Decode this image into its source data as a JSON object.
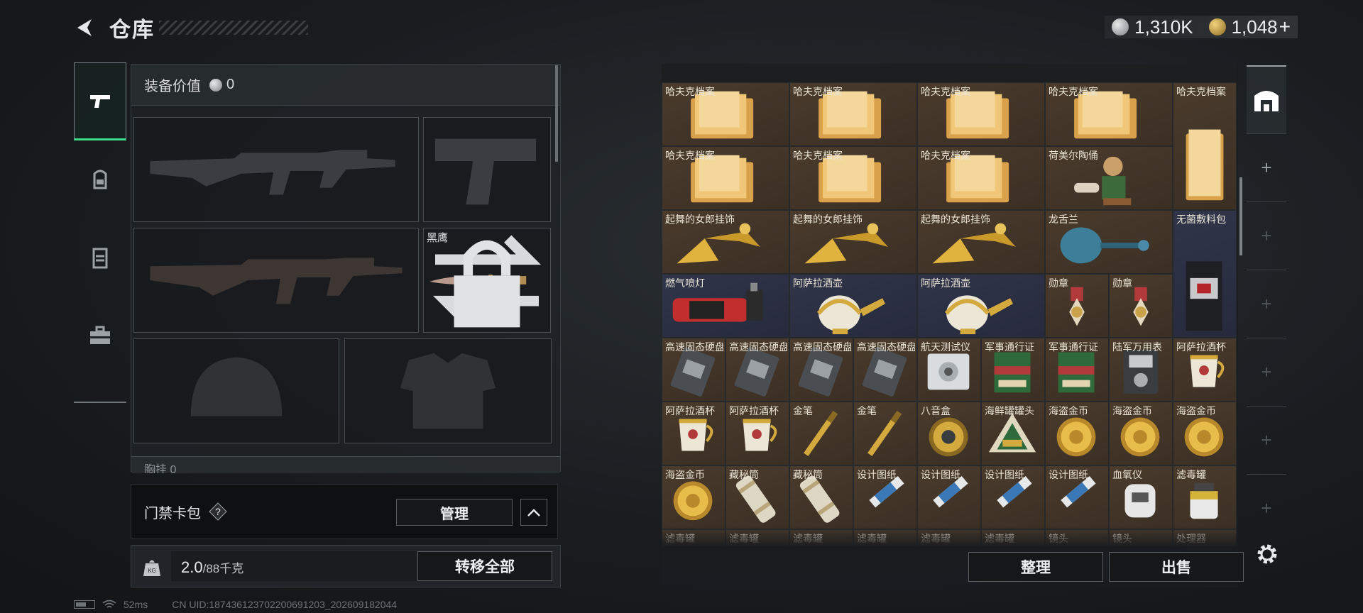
{
  "header": {
    "title": "仓库",
    "currency_silver": "1,310K",
    "currency_gold": "1,048",
    "add_symbol": "+"
  },
  "tabs": [
    {
      "name": "weapons",
      "icon": "pistol-icon"
    },
    {
      "name": "gear",
      "icon": "backpack-icon"
    },
    {
      "name": "vest",
      "icon": "vest-icon"
    },
    {
      "name": "toolbox",
      "icon": "toolbox-icon"
    }
  ],
  "loadout": {
    "equip_value_label": "装备价值",
    "equip_value": "0",
    "knife_label": "黑鹰",
    "chest_label": "胸挂 0"
  },
  "access_card": {
    "label": "门禁卡包",
    "help": "?",
    "manage_label": "管理"
  },
  "weight": {
    "current": "2.0",
    "max": "/88千克",
    "transfer_label": "转移全部"
  },
  "status": {
    "ping": "52ms",
    "uid": "CN UID:18743612370220069​1203_202609182044"
  },
  "storage": {
    "sort_label": "整理",
    "sell_label": "出售",
    "items": [
      {
        "name": "哈夫克档案",
        "icon": "folder",
        "c": 0,
        "r": 0,
        "w": 2,
        "h": 1
      },
      {
        "name": "哈夫克档案",
        "icon": "folder",
        "c": 2,
        "r": 0,
        "w": 2,
        "h": 1
      },
      {
        "name": "哈夫克档案",
        "icon": "folder",
        "c": 4,
        "r": 0,
        "w": 2,
        "h": 1
      },
      {
        "name": "哈夫克档案",
        "icon": "folder",
        "c": 6,
        "r": 0,
        "w": 2,
        "h": 1
      },
      {
        "name": "哈夫克档案",
        "icon": "folder-tall",
        "c": 8,
        "r": 0,
        "w": 1,
        "h": 2
      },
      {
        "name": "哈夫克档案",
        "icon": "folder",
        "c": 0,
        "r": 1,
        "w": 2,
        "h": 1
      },
      {
        "name": "哈夫克档案",
        "icon": "folder",
        "c": 2,
        "r": 1,
        "w": 2,
        "h": 1
      },
      {
        "name": "哈夫克档案",
        "icon": "folder",
        "c": 4,
        "r": 1,
        "w": 2,
        "h": 1
      },
      {
        "name": "荷美尔陶俑",
        "icon": "figurine",
        "c": 6,
        "r": 1,
        "w": 2,
        "h": 1
      },
      {
        "name": "起舞的女郎挂饰",
        "icon": "dancer",
        "c": 0,
        "r": 2,
        "w": 2,
        "h": 1
      },
      {
        "name": "起舞的女郎挂饰",
        "icon": "dancer",
        "c": 2,
        "r": 2,
        "w": 2,
        "h": 1
      },
      {
        "name": "起舞的女郎挂饰",
        "icon": "dancer",
        "c": 4,
        "r": 2,
        "w": 2,
        "h": 1
      },
      {
        "name": "龙舌兰",
        "icon": "bottle",
        "c": 6,
        "r": 2,
        "w": 2,
        "h": 1
      },
      {
        "name": "无菌敷料包",
        "icon": "pack",
        "c": 8,
        "r": 2,
        "w": 1,
        "h": 2,
        "blue": true
      },
      {
        "name": "燃气喷灯",
        "icon": "torch",
        "c": 0,
        "r": 3,
        "w": 2,
        "h": 1,
        "blue": true
      },
      {
        "name": "阿萨拉酒壶",
        "icon": "jug",
        "c": 2,
        "r": 3,
        "w": 2,
        "h": 1,
        "blue": true
      },
      {
        "name": "阿萨拉酒壶",
        "icon": "jug",
        "c": 4,
        "r": 3,
        "w": 2,
        "h": 1,
        "blue": true
      },
      {
        "name": "勋章",
        "icon": "medal",
        "c": 6,
        "r": 3,
        "w": 1,
        "h": 1
      },
      {
        "name": "勋章",
        "icon": "medal",
        "c": 7,
        "r": 3,
        "w": 1,
        "h": 1
      },
      {
        "name": "高速固态硬盘",
        "icon": "ssd",
        "c": 0,
        "r": 4,
        "w": 1,
        "h": 1
      },
      {
        "name": "高速固态硬盘",
        "icon": "ssd",
        "c": 1,
        "r": 4,
        "w": 1,
        "h": 1
      },
      {
        "name": "高速固态硬盘",
        "icon": "ssd",
        "c": 2,
        "r": 4,
        "w": 1,
        "h": 1
      },
      {
        "name": "高速固态硬盘",
        "icon": "ssd",
        "c": 3,
        "r": 4,
        "w": 1,
        "h": 1
      },
      {
        "name": "航天测试仪",
        "icon": "device",
        "c": 4,
        "r": 4,
        "w": 1,
        "h": 1
      },
      {
        "name": "军事通行证",
        "icon": "passbook",
        "c": 5,
        "r": 4,
        "w": 1,
        "h": 1
      },
      {
        "name": "军事通行证",
        "icon": "passbook",
        "c": 6,
        "r": 4,
        "w": 1,
        "h": 1
      },
      {
        "name": "陆军万用表",
        "icon": "meter",
        "c": 7,
        "r": 4,
        "w": 1,
        "h": 1
      },
      {
        "name": "阿萨拉酒杯",
        "icon": "cup",
        "c": 8,
        "r": 4,
        "w": 1,
        "h": 1
      },
      {
        "name": "阿萨拉酒杯",
        "icon": "cup",
        "c": 0,
        "r": 5,
        "w": 1,
        "h": 1
      },
      {
        "name": "阿萨拉酒杯",
        "icon": "cup",
        "c": 1,
        "r": 5,
        "w": 1,
        "h": 1
      },
      {
        "name": "金笔",
        "icon": "pen",
        "c": 2,
        "r": 5,
        "w": 1,
        "h": 1
      },
      {
        "name": "金笔",
        "icon": "pen",
        "c": 3,
        "r": 5,
        "w": 1,
        "h": 1
      },
      {
        "name": "八音盒",
        "icon": "musicbox",
        "c": 4,
        "r": 5,
        "w": 1,
        "h": 1
      },
      {
        "name": "海鲜罐罐头",
        "icon": "can",
        "c": 5,
        "r": 5,
        "w": 1,
        "h": 1
      },
      {
        "name": "海盗金币",
        "icon": "coin",
        "c": 6,
        "r": 5,
        "w": 1,
        "h": 1
      },
      {
        "name": "海盗金币",
        "icon": "coin",
        "c": 7,
        "r": 5,
        "w": 1,
        "h": 1
      },
      {
        "name": "海盗金币",
        "icon": "coin",
        "c": 8,
        "r": 5,
        "w": 1,
        "h": 1
      },
      {
        "name": "海盗金币",
        "icon": "coin",
        "c": 0,
        "r": 6,
        "w": 1,
        "h": 1
      },
      {
        "name": "藏秘筒",
        "icon": "cylinder",
        "c": 1,
        "r": 6,
        "w": 1,
        "h": 1
      },
      {
        "name": "藏秘筒",
        "icon": "cylinder",
        "c": 2,
        "r": 6,
        "w": 1,
        "h": 1
      },
      {
        "name": "设计图纸",
        "icon": "blueprint",
        "c": 3,
        "r": 6,
        "w": 1,
        "h": 1
      },
      {
        "name": "设计图纸",
        "icon": "blueprint",
        "c": 4,
        "r": 6,
        "w": 1,
        "h": 1
      },
      {
        "name": "设计图纸",
        "icon": "blueprint",
        "c": 5,
        "r": 6,
        "w": 1,
        "h": 1
      },
      {
        "name": "设计图纸",
        "icon": "blueprint",
        "c": 6,
        "r": 6,
        "w": 1,
        "h": 1
      },
      {
        "name": "血氧仪",
        "icon": "oximeter",
        "c": 7,
        "r": 6,
        "w": 1,
        "h": 1
      },
      {
        "name": "滤毒罐",
        "icon": "filter",
        "c": 8,
        "r": 6,
        "w": 1,
        "h": 1
      },
      {
        "name": "滤毒罐",
        "icon": "none",
        "c": 0,
        "r": 7,
        "w": 1,
        "h": 1
      },
      {
        "name": "滤毒罐",
        "icon": "none",
        "c": 1,
        "r": 7,
        "w": 1,
        "h": 1
      },
      {
        "name": "滤毒罐",
        "icon": "none",
        "c": 2,
        "r": 7,
        "w": 1,
        "h": 1
      },
      {
        "name": "滤毒罐",
        "icon": "none",
        "c": 3,
        "r": 7,
        "w": 1,
        "h": 1
      },
      {
        "name": "滤毒罐",
        "icon": "none",
        "c": 4,
        "r": 7,
        "w": 1,
        "h": 1
      },
      {
        "name": "滤毒罐",
        "icon": "none",
        "c": 5,
        "r": 7,
        "w": 1,
        "h": 1
      },
      {
        "name": "镜头",
        "icon": "none",
        "c": 6,
        "r": 7,
        "w": 1,
        "h": 1
      },
      {
        "name": "镜头",
        "icon": "none",
        "c": 7,
        "r": 7,
        "w": 1,
        "h": 1
      },
      {
        "name": "处理器",
        "icon": "none",
        "c": 8,
        "r": 7,
        "w": 1,
        "h": 1
      }
    ]
  },
  "right_strip": {
    "add_symbol": "+"
  }
}
